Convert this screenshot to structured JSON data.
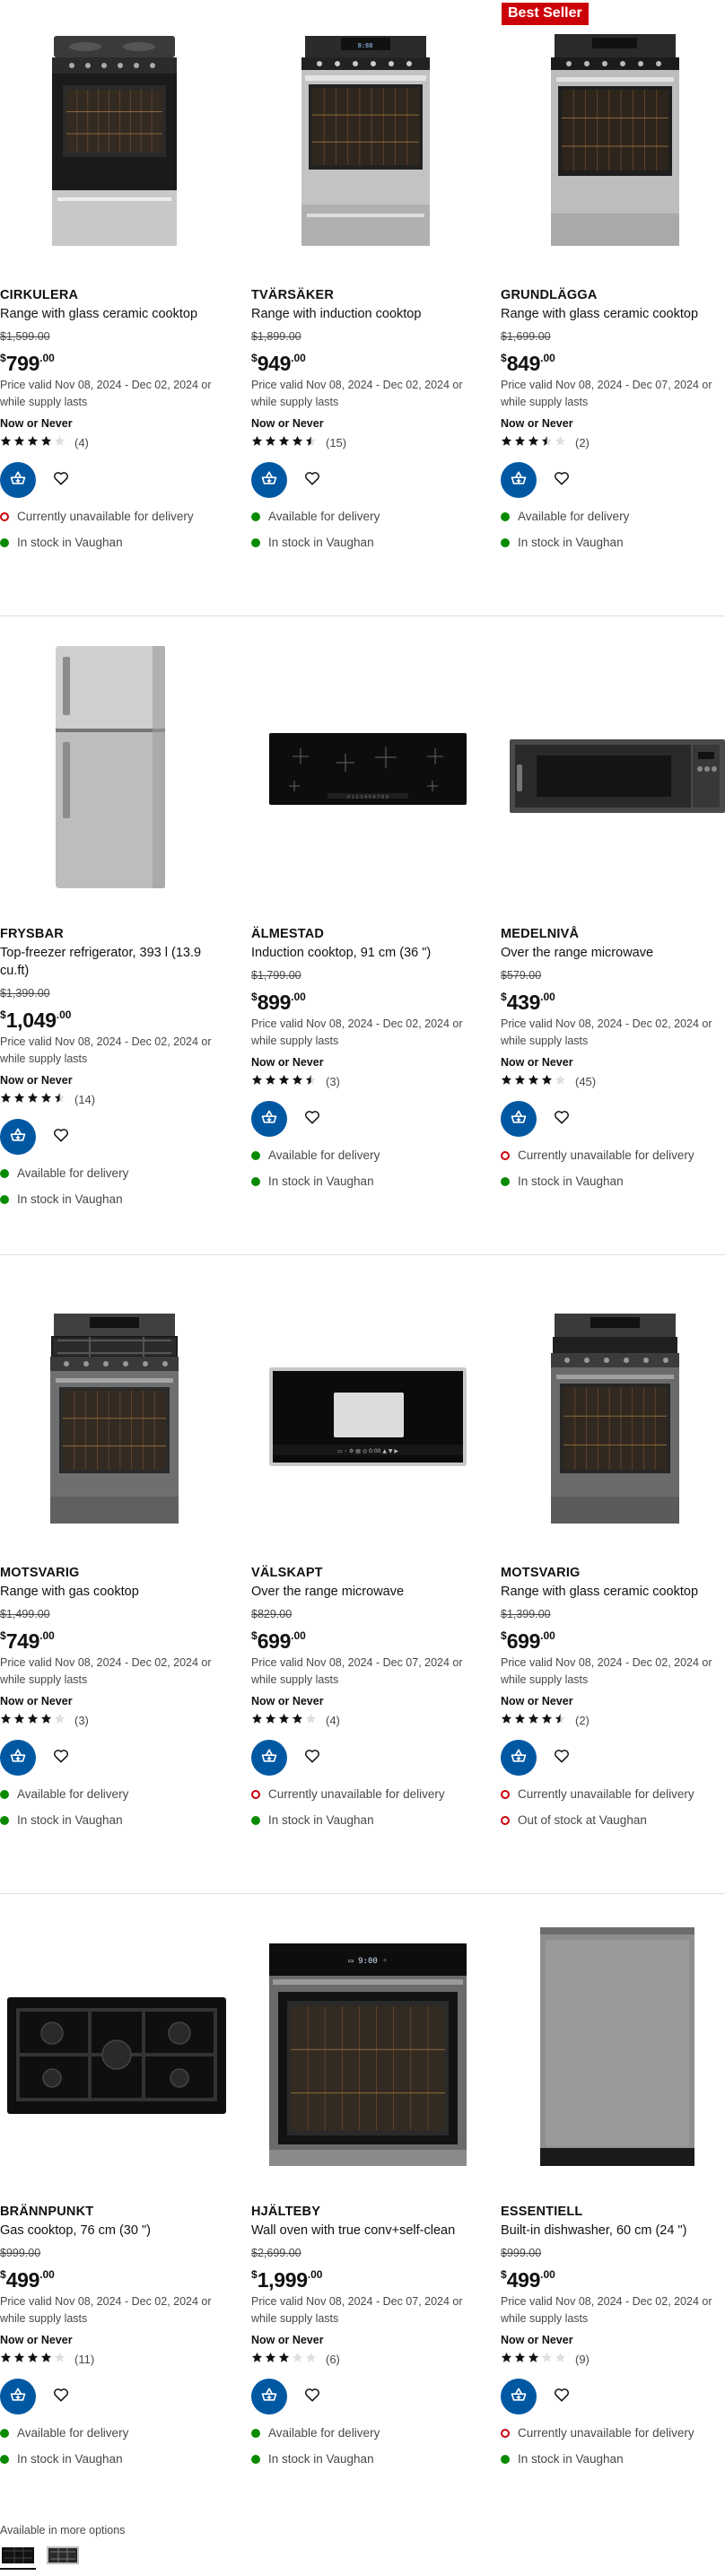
{
  "colors": {
    "accent": "#0058a3",
    "available": "#0a8a00",
    "unavailable": "#cc0008",
    "badge": "#cc0008"
  },
  "labels": {
    "price_valid_prefix": "Price valid",
    "now_or_never": "Now or Never",
    "available_delivery": "Available for delivery",
    "unavailable_delivery": "Currently unavailable for delivery",
    "in_stock": "In stock in Vaughan",
    "out_of_stock": "Out of stock at Vaughan",
    "add_to_cart_icon": "cart-plus-icon",
    "favourite_icon": "heart-outline-icon"
  },
  "products": [
    {
      "name": "CIRKULERA",
      "desc": "Range with glass ceramic cooktop",
      "old_price": "$1,599.00",
      "currency": "$",
      "price_int": "799",
      "price_dec": ".00",
      "valid": "Price valid Nov 08, 2024 - Dec 02, 2024 or while supply lasts",
      "badge": "",
      "rating": 4,
      "reviews": "(4)",
      "delivery": "unavailable",
      "stock": "in",
      "image": "range-glass-black"
    },
    {
      "name": "TVÄRSÄKER",
      "desc": "Range with induction cooktop",
      "old_price": "$1,899.00",
      "currency": "$",
      "price_int": "949",
      "price_dec": ".00",
      "valid": "Price valid Nov 08, 2024 - Dec 02, 2024 or while supply lasts",
      "badge": "",
      "rating": 4.5,
      "reviews": "(15)",
      "delivery": "available",
      "stock": "in",
      "image": "range-induction-steel"
    },
    {
      "name": "GRUNDLÄGGA",
      "desc": "Range with glass ceramic cooktop",
      "old_price": "$1,699.00",
      "currency": "$",
      "price_int": "849",
      "price_dec": ".00",
      "valid": "Price valid Nov 08, 2024 - Dec 07, 2024 or while supply lasts",
      "badge": "Best Seller",
      "rating": 3.5,
      "reviews": "(2)",
      "delivery": "available",
      "stock": "in",
      "image": "range-glass-steel"
    },
    {
      "name": "FRYSBAR",
      "desc": "Top-freezer refrigerator, 393 l (13.9 cu.ft)",
      "old_price": "$1,399.00",
      "currency": "$",
      "price_int": "1,049",
      "price_dec": ".00",
      "valid": "Price valid Nov 08, 2024 - Dec 02, 2024 or while supply lasts",
      "badge": "",
      "rating": 4.5,
      "reviews": "(14)",
      "delivery": "available",
      "stock": "in",
      "image": "fridge"
    },
    {
      "name": "ÄLMESTAD",
      "desc": "Induction cooktop, 91 cm (36 \")",
      "old_price": "$1,799.00",
      "currency": "$",
      "price_int": "899",
      "price_dec": ".00",
      "valid": "Price valid Nov 08, 2024 - Dec 02, 2024 or while supply lasts",
      "badge": "",
      "rating": 4.5,
      "reviews": "(3)",
      "delivery": "available",
      "stock": "in",
      "image": "cooktop-induction"
    },
    {
      "name": "MEDELNIVÅ",
      "desc": "Over the range microwave",
      "old_price": "$579.00",
      "currency": "$",
      "price_int": "439",
      "price_dec": ".00",
      "valid": "Price valid Nov 08, 2024 - Dec 02, 2024 or while supply lasts",
      "badge": "",
      "rating": 4,
      "reviews": "(45)",
      "delivery": "unavailable",
      "stock": "in",
      "image": "microwave-dark"
    },
    {
      "name": "MOTSVARIG",
      "desc": "Range with gas cooktop",
      "old_price": "$1,499.00",
      "currency": "$",
      "price_int": "749",
      "price_dec": ".00",
      "valid": "Price valid Nov 08, 2024 - Dec 02, 2024 or while supply lasts",
      "badge": "",
      "rating": 4,
      "reviews": "(3)",
      "delivery": "available",
      "stock": "in",
      "image": "range-gas"
    },
    {
      "name": "VÄLSKAPT",
      "desc": "Over the range microwave",
      "old_price": "$829.00",
      "currency": "$",
      "price_int": "699",
      "price_dec": ".00",
      "valid": "Price valid Nov 08, 2024 - Dec 07, 2024 or while supply lasts",
      "badge": "",
      "rating": 4,
      "reviews": "(4)",
      "delivery": "unavailable",
      "stock": "in",
      "image": "microwave-black"
    },
    {
      "name": "MOTSVARIG",
      "desc": "Range with glass ceramic cooktop",
      "old_price": "$1,399.00",
      "currency": "$",
      "price_int": "699",
      "price_dec": ".00",
      "valid": "Price valid Nov 08, 2024 - Dec 02, 2024 or while supply lasts",
      "badge": "",
      "rating": 4.5,
      "reviews": "(2)",
      "delivery": "unavailable",
      "stock": "out",
      "image": "range-glass-dark"
    },
    {
      "name": "BRÄNNPUNKT",
      "desc": "Gas cooktop, 76 cm (30 \")",
      "old_price": "$999.00",
      "currency": "$",
      "price_int": "499",
      "price_dec": ".00",
      "valid": "Price valid Nov 08, 2024 - Dec 02, 2024 or while supply lasts",
      "badge": "",
      "rating": 4,
      "reviews": "(11)",
      "delivery": "available",
      "stock": "in",
      "image": "cooktop-gas"
    },
    {
      "name": "HJÄLTEBY",
      "desc": "Wall oven with true conv+self-clean",
      "old_price": "$2,699.00",
      "currency": "$",
      "price_int": "1,999",
      "price_dec": ".00",
      "valid": "Price valid Nov 08, 2024 - Dec 07, 2024 or while supply lasts",
      "badge": "",
      "rating": 3,
      "reviews": "(6)",
      "delivery": "available",
      "stock": "in",
      "image": "wall-oven"
    },
    {
      "name": "ESSENTIELL",
      "desc": "Built-in dishwasher, 60 cm (24 \")",
      "old_price": "$999.00",
      "currency": "$",
      "price_int": "499",
      "price_dec": ".00",
      "valid": "Price valid Nov 08, 2024 - Dec 02, 2024 or while supply lasts",
      "badge": "",
      "rating": 3,
      "reviews": "(9)",
      "delivery": "unavailable",
      "stock": "in",
      "image": "dishwasher"
    }
  ],
  "more_options": {
    "label": "Available in more options",
    "swatches": [
      "cooktop-gas-thumb",
      "cooktop-gas-steel-thumb"
    ]
  }
}
